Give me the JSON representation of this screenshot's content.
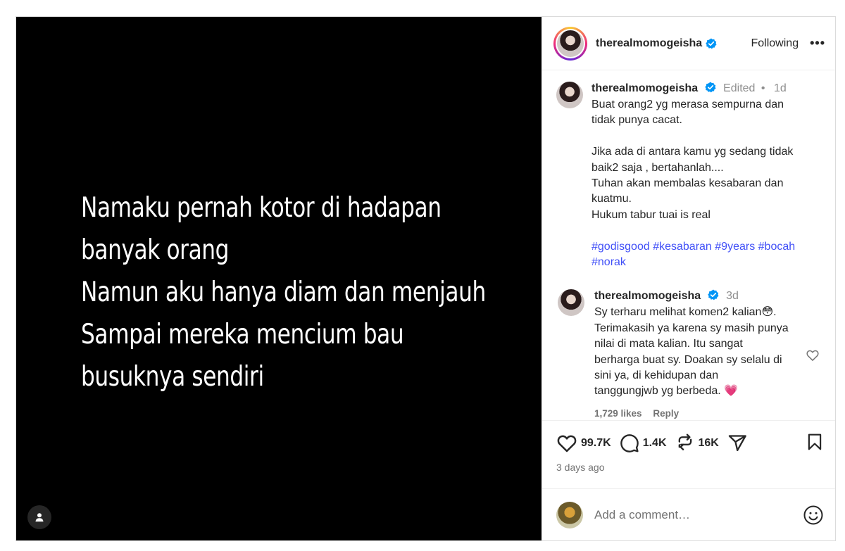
{
  "media": {
    "lines": [
      "Namaku pernah kotor di hadapan",
      "banyak orang",
      "Namun aku hanya diam dan menjauh",
      "Sampai mereka mencium bau",
      "busuknya sendiri"
    ],
    "tag_icon": "user-icon"
  },
  "header": {
    "username": "therealmomogeisha",
    "following_label": "Following",
    "more_label": "•••"
  },
  "caption": {
    "username": "therealmomogeisha",
    "edited": "Edited",
    "separator": "•",
    "time": "1d",
    "lines": [
      "Buat orang2 yg merasa sempurna dan",
      "tidak punya cacat.",
      "",
      "Jika ada di antara kamu yg sedang tidak",
      "baik2 saja , bertahanlah....",
      "Tuhan akan membalas kesabaran dan",
      "kuatmu.",
      "Hukum tabur tuai is real",
      ""
    ],
    "hashtags": [
      "#godisgood",
      "#kesabaran",
      "#9years",
      "#bocah",
      "#norak"
    ]
  },
  "reply": {
    "username": "therealmomogeisha",
    "time": "3d",
    "lines": [
      "Sy terharu melihat komen2 kalian😳.",
      "Terimakasih ya karena sy masih punya",
      "nilai di mata kalian. Itu sangat",
      "berharga buat sy. Doakan sy selalu di",
      "sini ya, di kehidupan dan",
      "tanggungjwb yg berbeda. 💗"
    ],
    "likes": "1,729 likes",
    "reply_label": "Reply"
  },
  "actions": {
    "likes": "99.7K",
    "comments": "1.4K",
    "reposts": "16K",
    "date": "3 days ago"
  },
  "comment_box": {
    "placeholder": "Add a comment…"
  },
  "colors": {
    "verified": "#0095f6",
    "hashtag": "#4150f7",
    "muted": "#737373"
  }
}
